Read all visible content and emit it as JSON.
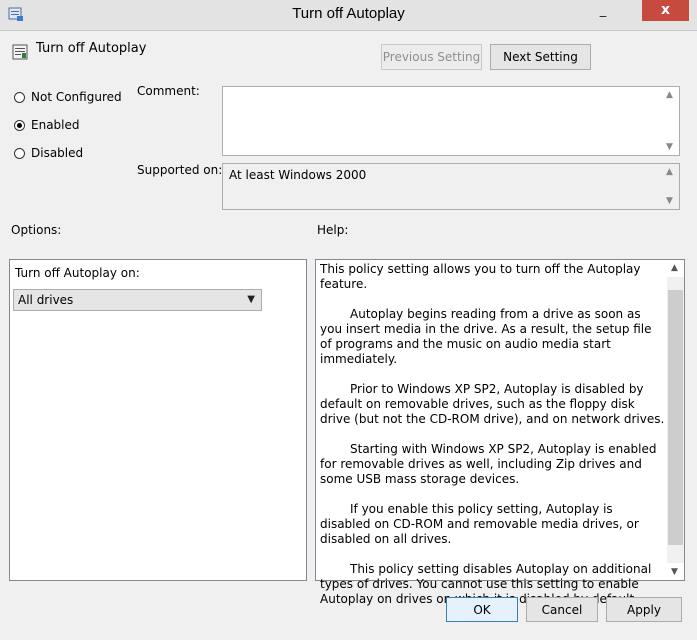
{
  "window": {
    "title": "Turn off Autoplay",
    "minimize_glyph": "_",
    "close_glyph": "x"
  },
  "header": {
    "policy_name": "Turn off Autoplay",
    "previous_label": "Previous Setting",
    "next_label": "Next Setting"
  },
  "state": {
    "options": [
      {
        "label": "Not Configured",
        "checked": false
      },
      {
        "label": "Enabled",
        "checked": true
      },
      {
        "label": "Disabled",
        "checked": false
      }
    ]
  },
  "comment": {
    "label": "Comment:",
    "value": ""
  },
  "supported": {
    "label": "Supported on:",
    "value": "At least Windows 2000"
  },
  "options_section": {
    "label": "Options:",
    "dropdown_label": "Turn off Autoplay on:",
    "dropdown_value": "All drives"
  },
  "help_section": {
    "label": "Help:",
    "paragraphs": [
      "This policy setting allows you to turn off the Autoplay feature.",
      "Autoplay begins reading from a drive as soon as you insert media in the drive. As a result, the setup file of programs and the music on audio media start immediately.",
      "Prior to Windows XP SP2, Autoplay is disabled by default on removable drives, such as the floppy disk drive (but not the CD-ROM drive), and on network drives.",
      "Starting with Windows XP SP2, Autoplay is enabled for removable drives as well, including Zip drives and some USB mass storage devices.",
      "If you enable this policy setting, Autoplay is disabled on CD-ROM and removable media drives, or disabled on all drives.",
      "This policy setting disables Autoplay on additional types of drives. You cannot use this setting to enable Autoplay on drives on which it is disabled by default."
    ]
  },
  "footer": {
    "ok": "OK",
    "cancel": "Cancel",
    "apply": "Apply"
  },
  "icons": {
    "app": "policy-app-icon",
    "policy": "policy-setting-icon"
  },
  "colors": {
    "close": "#c74a3e",
    "ok_border": "#3c7fb1",
    "window_bg": "#f0f0f0"
  }
}
